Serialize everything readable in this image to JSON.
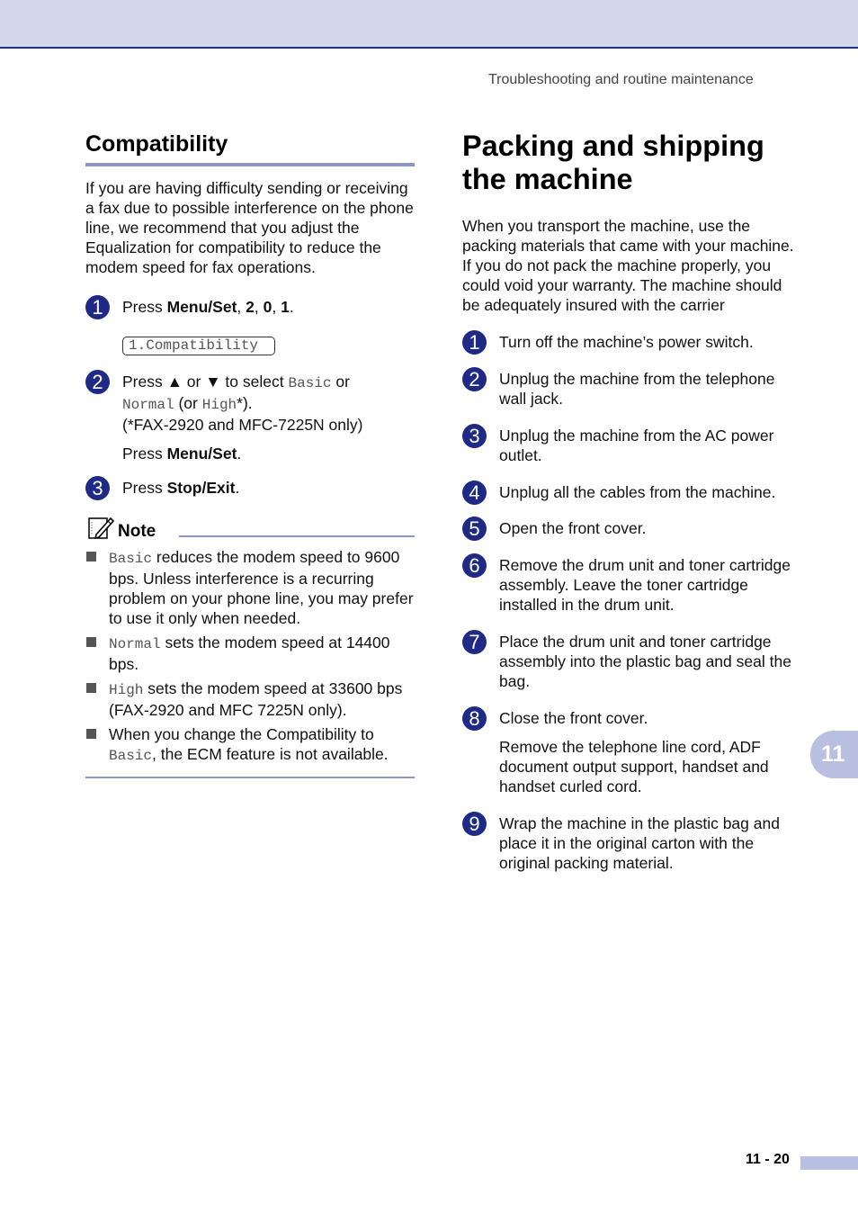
{
  "header": {
    "running_title": "Troubleshooting and routine maintenance"
  },
  "compatibility": {
    "title": "Compatibility",
    "intro": "If you are having difficulty sending or receiving a fax due to possible interference on the phone line, we recommend that you adjust the Equalization for compatibility to reduce the modem speed for fax operations.",
    "steps": [
      {
        "number": "1",
        "press": "Press ",
        "key1": "Menu/Set",
        "sep1": ", ",
        "key2": "2",
        "sep2": ", ",
        "key3": "0",
        "sep3": ", ",
        "key4": "1",
        "end": ".",
        "lcd": "1.Compatibility"
      },
      {
        "number": "2",
        "text_a": "Press ",
        "up_arrow": "▲",
        "text_b": " or ",
        "down_arrow": "▼",
        "text_c": " to select ",
        "opt1": "Basic",
        "text_d": " or ",
        "opt2": "Normal",
        "text_e": " (or ",
        "opt3": "High",
        "text_f": "*).",
        "footnote": "(*FAX-2920 and MFC-7225N only)",
        "press": "Press ",
        "key": "Menu/Set",
        "end": "."
      },
      {
        "number": "3",
        "press": "Press ",
        "key": "Stop/Exit",
        "end": "."
      }
    ],
    "note": {
      "label": "Note",
      "items": [
        {
          "mono": "Basic",
          "text": " reduces the modem speed to 9600 bps. Unless interference is a recurring problem on your phone line, you may prefer to use it only when needed."
        },
        {
          "mono": "Normal",
          "text": " sets the modem speed at 14400 bps."
        },
        {
          "mono": "High",
          "text": " sets the modem speed at 33600 bps (FAX-2920 and MFC 7225N only)."
        },
        {
          "pre": "When you change the Compatibility to ",
          "mono": "Basic",
          "text": ", the ECM feature is not available."
        }
      ]
    }
  },
  "packing": {
    "title_line1": "Packing and shipping",
    "title_line2": "the machine",
    "intro": "When you transport the machine, use the packing materials that came with your machine. If you do not pack the machine properly, you could void your warranty. The machine should be adequately insured with the carrier",
    "steps": [
      {
        "number": "1",
        "text": "Turn off the machine’s power switch."
      },
      {
        "number": "2",
        "text": "Unplug the machine from the telephone wall jack."
      },
      {
        "number": "3",
        "text": "Unplug the machine from the AC power outlet."
      },
      {
        "number": "4",
        "text": "Unplug all the cables from the machine."
      },
      {
        "number": "5",
        "text": "Open the front cover."
      },
      {
        "number": "6",
        "text": "Remove the drum unit and toner cartridge assembly. Leave the toner cartridge installed in the drum unit."
      },
      {
        "number": "7",
        "text": "Place the drum unit and toner cartridge assembly into the plastic bag and seal the bag."
      },
      {
        "number": "8",
        "text": "Close the front cover.",
        "extra": "Remove the telephone line cord, ADF document output support, handset and handset curled cord."
      },
      {
        "number": "9",
        "text": "Wrap the machine in the plastic bag and place it in the original carton with the original packing material."
      }
    ]
  },
  "footer": {
    "chapter_tab": "11",
    "page_number": "11 - 20"
  },
  "colors": {
    "band": "#d2d7ea",
    "band_rule": "#1f3189",
    "step_circle": "#1f2a86",
    "accent_rule": "#8c97c8",
    "tab": "#b9bfe0"
  }
}
